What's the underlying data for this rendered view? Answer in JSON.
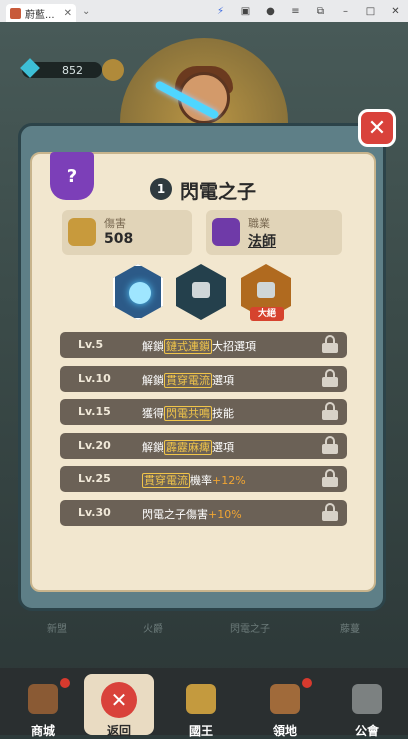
{
  "browser": {
    "tab_title": "蔚藍...",
    "tab_close": "✕",
    "tab_chevron": "⌄",
    "icons": [
      "lightning-icon",
      "window-icon",
      "account-icon",
      "menu-icon",
      "restore-icon",
      "minimize-icon",
      "maximize-icon",
      "close-window-icon"
    ],
    "accent": "#3d6be0"
  },
  "currency": {
    "gems": "852"
  },
  "dialog": {
    "close_symbol": "✕",
    "class_glyph": "?",
    "level": "1",
    "title": "閃電之子",
    "stats": {
      "damage_label": "傷害",
      "damage_value": "508",
      "class_label": "職業",
      "class_value": "法師"
    },
    "ult_badge": "大絕",
    "unlocks": [
      {
        "level": "Lv.5",
        "pre": "解鎖",
        "hl": "鏈式連鎖",
        "post": "大招選項",
        "plus": ""
      },
      {
        "level": "Lv.10",
        "pre": "解鎖",
        "hl": "貫穿電流",
        "post": "選項",
        "plus": ""
      },
      {
        "level": "Lv.15",
        "pre": "獲得",
        "hl": "閃電共鳴",
        "post": "技能",
        "plus": ""
      },
      {
        "level": "Lv.20",
        "pre": "解鎖",
        "hl": "霹靂麻痺",
        "post": "選項",
        "plus": ""
      },
      {
        "level": "Lv.25",
        "pre": "",
        "hl": "貫穿電流",
        "post": "機率",
        "plus": "+12%"
      },
      {
        "level": "Lv.30",
        "pre": "閃電之子傷害",
        "hl": "",
        "post": "",
        "plus": "+10%"
      }
    ],
    "colors": {
      "close": "#d9423b",
      "highlight": "#f1c54a",
      "plus": "#f0a533"
    }
  },
  "hero_tabs": [
    "新盟",
    "火爵",
    "閃電之子",
    "藤蔓"
  ],
  "bottom_nav": [
    {
      "label": "商城",
      "icon": "shop-icon",
      "badge": true
    },
    {
      "label": "返回",
      "icon": "back-icon",
      "active": true
    },
    {
      "label": "國王",
      "icon": "crown-icon",
      "badge": false
    },
    {
      "label": "領地",
      "icon": "castle-icon",
      "badge": true
    },
    {
      "label": "公會",
      "icon": "lock-icon",
      "badge": false
    }
  ]
}
